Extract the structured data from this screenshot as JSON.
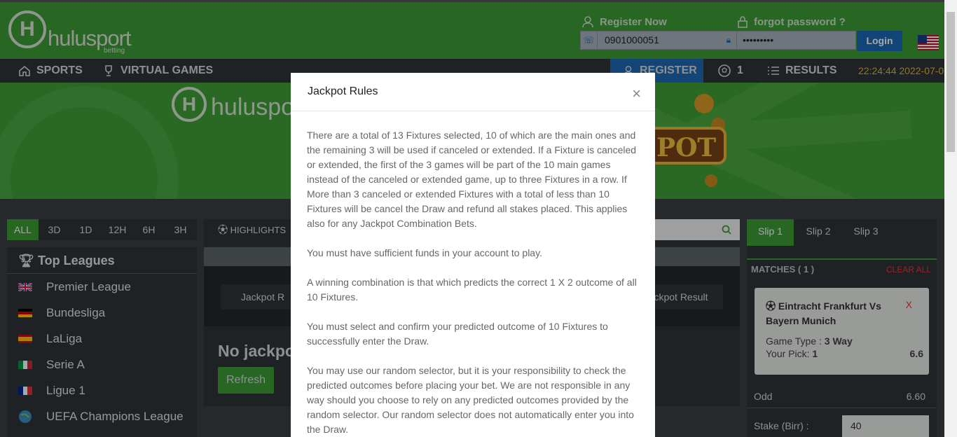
{
  "header": {
    "logo_text": "hulusport",
    "logo_sub": "betting",
    "register_now": "Register Now",
    "forgot_password": "forgot password ?",
    "phone_value": "0901000051",
    "password_value": "•••••••••",
    "login_label": "Login"
  },
  "nav": {
    "sports": "SPORTS",
    "virtual_games": "VIRTUAL GAMES",
    "register": "REGISTER",
    "bet_count": "1",
    "results": "RESULTS",
    "clock": "22:24:44 2022-07-0"
  },
  "banner": {
    "logo_text": "hulusport",
    "jackpot_text": "POT"
  },
  "filters": [
    "ALL",
    "3D",
    "1D",
    "12H",
    "6H",
    "3H"
  ],
  "leagues": {
    "title": "Top Leagues",
    "items": [
      {
        "label": "Premier League",
        "flag": "uk"
      },
      {
        "label": "Bundesliga",
        "flag": "de"
      },
      {
        "label": "LaLiga",
        "flag": "es"
      },
      {
        "label": "Serie A",
        "flag": "it"
      },
      {
        "label": "Ligue 1",
        "flag": "fr"
      },
      {
        "label": "UEFA Champions League",
        "flag": "globe"
      }
    ]
  },
  "center": {
    "highlights": "HIGHLIGHTS",
    "jackpot_tab_left": "Jackpot R",
    "jackpot_tab_right": "ckpot Result",
    "no_jackpot": "No jackpo",
    "refresh": "Refresh"
  },
  "slip": {
    "tabs": [
      "Slip 1",
      "Slip 2",
      "Slip 3"
    ],
    "matches_label": "MATCHES ( 1 )",
    "clear_all": "CLEAR ALL",
    "match_title": "Eintracht Frankfurt Vs Bayern Munich",
    "remove": "X",
    "game_type_label": "Game Type :",
    "game_type_value": "3 Way",
    "pick_label": "Your Pick:",
    "pick_value": "1",
    "pick_odd": "6.6",
    "odd_label": "Odd",
    "odd_value": "6.60",
    "stake_label": "Stake (Birr) :",
    "stake_value": "40"
  },
  "modal": {
    "title": "Jackpot Rules",
    "close": "×",
    "paragraphs": [
      "There are a total of 13 Fixtures selected, 10 of which are the main ones and the remaining 3 will be used if canceled or extended. If a Fixture is canceled or extended, the first of the 3 games will be part of the 10 main games instead of the canceled or extended game, up to three Fixtures in a row. If More than 3 canceled or extended Fixtures with a total of less than 10 Fixtures will be cancel the Draw and refund all stakes placed. This applies also for any Jackpot Combination Bets.",
      "You must have sufficient funds in your account to play.",
      "A winning combination is that which predicts the correct 1 X 2 outcome of all 10 Fixtures.",
      "You must select and confirm your predicted outcome of 10 Fixtures to successfully enter the Draw.",
      "You may use our random selector, but it is your responsibility to check the predicted outcomes before placing your bet. We are not responsible in any way should you choose to rely on any predicted outcomes provided by the random selector. Our random selector does not automatically enter you into the Draw."
    ]
  }
}
